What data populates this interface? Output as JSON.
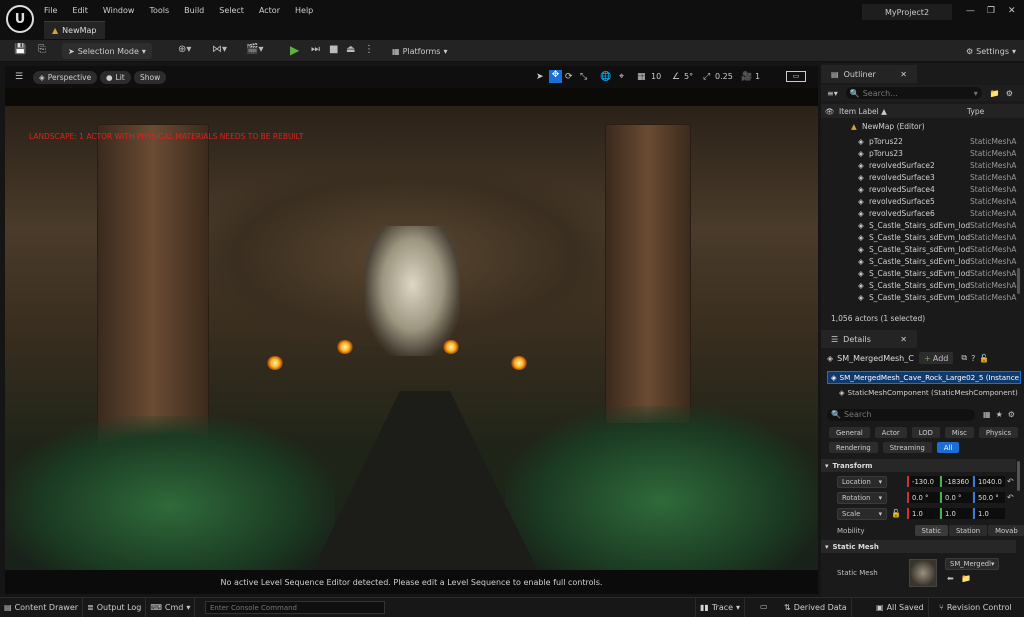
{
  "app": {
    "logo": "U",
    "project": "MyProject2"
  },
  "menu": [
    "File",
    "Edit",
    "Window",
    "Tools",
    "Build",
    "Select",
    "Actor",
    "Help"
  ],
  "document_tab": "NewMap",
  "toolbar": {
    "selection_mode": "Selection Mode",
    "platforms": "Platforms",
    "settings": "Settings"
  },
  "viewport": {
    "perspective": "Perspective",
    "lit": "Lit",
    "show": "Show",
    "grid_snap": "10",
    "rot_snap": "5°",
    "scale_snap": "0.25",
    "camera_speed": "1",
    "warning": "LANDSCAPE: 1 ACTOR WITH PHYSICAL MATERIALS NEEDS TO BE REBUILT",
    "footer": "No active Level Sequence Editor detected. Please edit a Level Sequence to enable full controls."
  },
  "outliner": {
    "tab": "Outliner",
    "search_placeholder": "Search...",
    "col_label": "Item Label ▲",
    "col_type": "Type",
    "root": "NewMap (Editor)",
    "rows": [
      {
        "name": "pTorus22",
        "type": "StaticMeshA"
      },
      {
        "name": "pTorus23",
        "type": "StaticMeshA"
      },
      {
        "name": "revolvedSurface2",
        "type": "StaticMeshA"
      },
      {
        "name": "revolvedSurface3",
        "type": "StaticMeshA"
      },
      {
        "name": "revolvedSurface4",
        "type": "StaticMeshA"
      },
      {
        "name": "revolvedSurface5",
        "type": "StaticMeshA"
      },
      {
        "name": "revolvedSurface6",
        "type": "StaticMeshA"
      },
      {
        "name": "S_Castle_Stairs_sdEvm_lod",
        "type": "StaticMeshA"
      },
      {
        "name": "S_Castle_Stairs_sdEvm_lod",
        "type": "StaticMeshA"
      },
      {
        "name": "S_Castle_Stairs_sdEvm_lod",
        "type": "StaticMeshA"
      },
      {
        "name": "S_Castle_Stairs_sdEvm_lod",
        "type": "StaticMeshA"
      },
      {
        "name": "S_Castle_Stairs_sdEvm_lod",
        "type": "StaticMeshA"
      },
      {
        "name": "S_Castle_Stairs_sdEvm_lod",
        "type": "StaticMeshA"
      },
      {
        "name": "S_Castle_Stairs_sdEvm_lod",
        "type": "StaticMeshA"
      }
    ],
    "footer": "1,056 actors (1 selected)"
  },
  "details": {
    "tab": "Details",
    "object_name": "SM_MergedMesh_C",
    "add_label": "Add",
    "selected_instance": "SM_MergedMesh_Cave_Rock_Large02_5 (Instance)",
    "component": "StaticMeshComponent (StaticMeshComponent)",
    "search_placeholder": "Search",
    "filters_row1": [
      "General",
      "Actor",
      "LOD",
      "Misc",
      "Physics"
    ],
    "filters_row2": [
      "Rendering",
      "Streaming",
      "All"
    ],
    "transform_header": "Transform",
    "location_label": "Location",
    "location": [
      "-130.0",
      "-18360",
      "1040.0"
    ],
    "rotation_label": "Rotation",
    "rotation": [
      "0.0 °",
      "0.0 °",
      "50.0 °"
    ],
    "scale_label": "Scale",
    "scale": [
      "1.0",
      "1.0",
      "1.0"
    ],
    "mobility_label": "Mobility",
    "mobility": [
      "Static",
      "Station",
      "Movab"
    ],
    "static_mesh_header": "Static Mesh",
    "static_mesh_label": "Static Mesh",
    "static_mesh_value": "SM_Mergedl"
  },
  "status": {
    "content_drawer": "Content Drawer",
    "output_log": "Output Log",
    "cmd": "Cmd",
    "console_placeholder": "Enter Console Command",
    "trace": "Trace",
    "derived_data": "Derived Data",
    "all_saved": "All Saved",
    "revision_control": "Revision Control"
  },
  "colors": {
    "accent": "#1a6fd6",
    "play": "#5ab53a",
    "x_axis": "#c83232",
    "y_axis": "#4caf50",
    "z_axis": "#3a7ad6"
  }
}
